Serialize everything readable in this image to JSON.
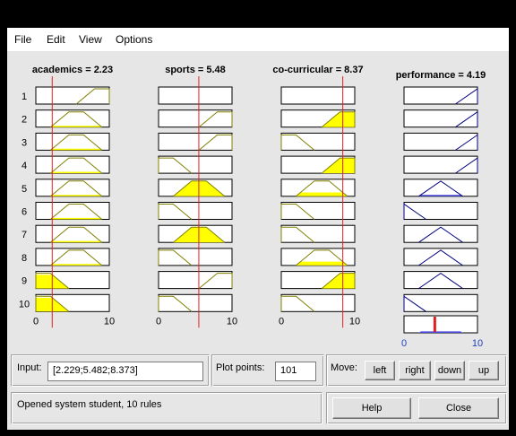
{
  "menu": [
    "File",
    "Edit",
    "View",
    "Options"
  ],
  "inputs": [
    {
      "name": "academics",
      "title": "academics = 2.23",
      "value": 2.23,
      "range": [
        0,
        10
      ]
    },
    {
      "name": "sports",
      "title": "sports = 5.48",
      "value": 5.48,
      "range": [
        0,
        10
      ]
    },
    {
      "name": "co-curricular",
      "title": "co-curricular = 8.37",
      "value": 8.37,
      "range": [
        0,
        10
      ]
    }
  ],
  "output": {
    "name": "performance",
    "title": "performance = 4.19",
    "value": 4.19,
    "range": [
      0,
      10
    ]
  },
  "rule_numbers": [
    "1",
    "2",
    "3",
    "4",
    "5",
    "6",
    "7",
    "8",
    "9",
    "10"
  ],
  "axis_ticks": {
    "min": "0",
    "max": "10"
  },
  "mf": {
    "in_low": [
      0,
      0,
      2,
      4.5
    ],
    "in_mid": [
      2,
      4.5,
      6.5,
      9
    ],
    "in_high": [
      5.5,
      8,
      10,
      10
    ],
    "out_low": [
      0,
      0,
      3
    ],
    "out_mid": [
      2,
      5,
      8
    ],
    "out_high": [
      7,
      10,
      10
    ]
  },
  "rules": [
    {
      "academics": "high",
      "sports": null,
      "co_curricular": null,
      "performance": "high"
    },
    {
      "academics": "mid",
      "sports": "high",
      "co_curricular": "high",
      "performance": "high"
    },
    {
      "academics": "mid",
      "sports": "high",
      "co_curricular": "low",
      "performance": "high"
    },
    {
      "academics": "mid",
      "sports": "low",
      "co_curricular": "high",
      "performance": "high"
    },
    {
      "academics": "mid",
      "sports": "mid",
      "co_curricular": "mid",
      "performance": "mid"
    },
    {
      "academics": "mid",
      "sports": "low",
      "co_curricular": "low",
      "performance": "low"
    },
    {
      "academics": "mid",
      "sports": "mid",
      "co_curricular": "low",
      "performance": "mid"
    },
    {
      "academics": "mid",
      "sports": "low",
      "co_curricular": "mid",
      "performance": "mid"
    },
    {
      "academics": "low",
      "sports": "high",
      "co_curricular": "high",
      "performance": "mid"
    },
    {
      "academics": "low",
      "sports": "low",
      "co_curricular": "low",
      "performance": "low"
    }
  ],
  "controls": {
    "input_label": "Input:",
    "input_value": "[2.229;5.482;8.373]",
    "plot_points_label": "Plot points:",
    "plot_points_value": "101",
    "move_label": "Move:",
    "left": "left",
    "right": "right",
    "down": "down",
    "up": "up",
    "status": "Opened system student, 10 rules",
    "help": "Help",
    "close": "Close"
  },
  "colors": {
    "fill": "#ffff00",
    "mf_line": "#808000",
    "out_line": "#000080",
    "agg": "#4a4ae0",
    "marker": "#e02020"
  }
}
